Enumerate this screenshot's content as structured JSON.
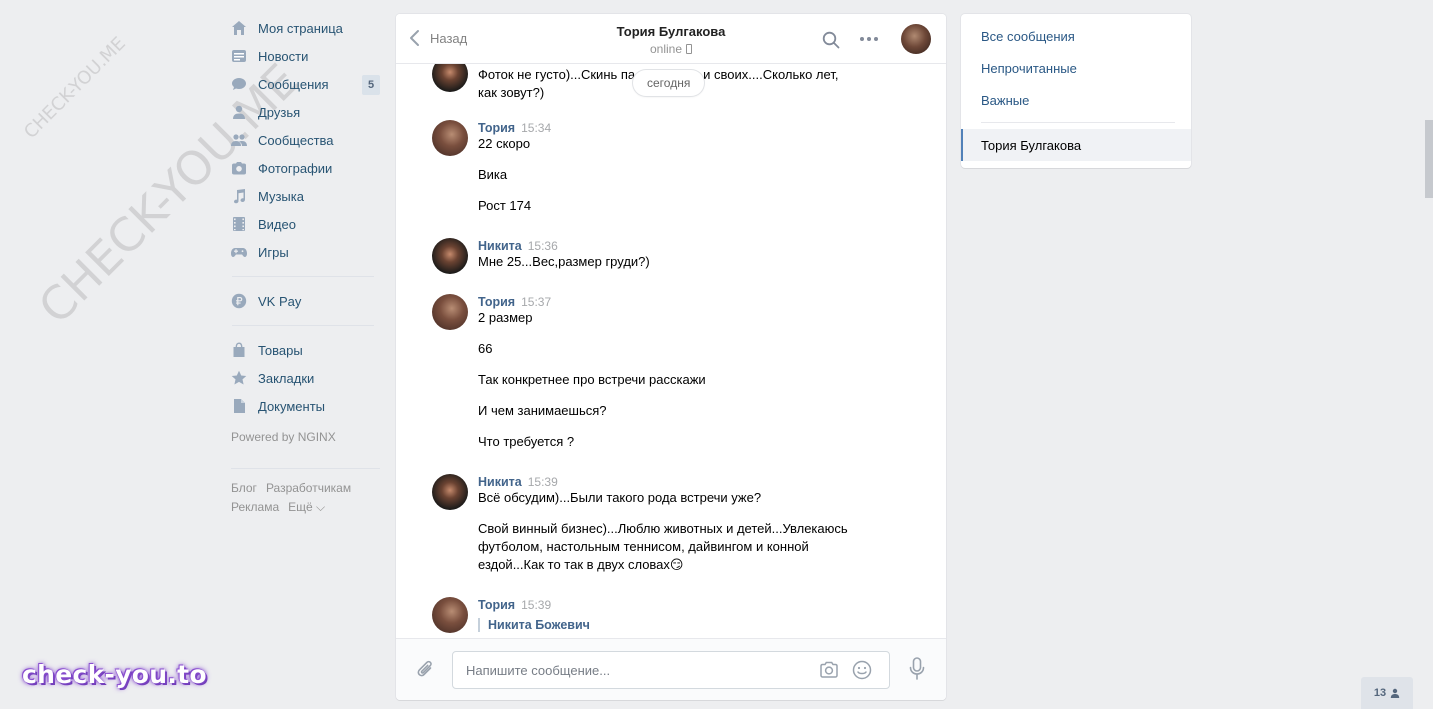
{
  "watermarks": {
    "small": "CHECK-YOU.ME",
    "big": "CHECK-YOU.ME",
    "bottom_logo": "check-you.to"
  },
  "left_nav": {
    "items": [
      {
        "label": "Моя страница",
        "icon": "home-icon"
      },
      {
        "label": "Новости",
        "icon": "news-icon"
      },
      {
        "label": "Сообщения",
        "icon": "messages-icon",
        "counter": "5"
      },
      {
        "label": "Друзья",
        "icon": "friends-icon"
      },
      {
        "label": "Сообщества",
        "icon": "communities-icon"
      },
      {
        "label": "Фотографии",
        "icon": "camera-icon"
      },
      {
        "label": "Музыка",
        "icon": "music-icon"
      },
      {
        "label": "Видео",
        "icon": "video-icon"
      },
      {
        "label": "Игры",
        "icon": "games-icon"
      }
    ],
    "vkpay": {
      "label": "VK Pay",
      "icon": "vkpay-icon"
    },
    "extra": [
      {
        "label": "Товары",
        "icon": "bag-icon"
      },
      {
        "label": "Закладки",
        "icon": "star-icon"
      },
      {
        "label": "Документы",
        "icon": "document-icon"
      }
    ],
    "powered": "Powered by NGINX",
    "footer": {
      "blog": "Блог",
      "dev": "Разработчикам",
      "ads": "Реклама",
      "more": "Ещё ⌵"
    }
  },
  "chat": {
    "back_label": "Назад",
    "peer_name": "Тория Булгакова",
    "peer_status": "online",
    "day_label": "сегодня",
    "partial_text": "Фоток не густо)...Скинь па",
    "partial_text_b": "и своих....Сколько лет,",
    "partial_text2": "как зовут?)",
    "messages": [
      {
        "author": "Тория",
        "time": "15:34",
        "lines": [
          "22 скоро",
          "Вика",
          "Рост 174"
        ]
      },
      {
        "author": "Никита",
        "time": "15:36",
        "lines": [
          "Мне 25...Вес,размер груди?)"
        ]
      },
      {
        "author": "Тория",
        "time": "15:37",
        "lines": [
          "2 размер",
          "66",
          "Так конкретнее про встречи расскажи",
          "И чем занимаешься?",
          "Что требуется ?"
        ]
      },
      {
        "author": "Никита",
        "time": "15:39",
        "lines": [
          "Всё обсудим)...Были такого рода встречи уже?",
          "Свой винный бизнес)...Люблю животных и детей...Увлекаюсь",
          "футболом, настольным теннисом, дайвингом и конной",
          "ездой...Как то так в двух словах😏"
        ]
      },
      {
        "author": "Тория",
        "time": "15:39",
        "reply_author": "Никита Божевич"
      }
    ],
    "composer_placeholder": "Напишите сообщение..."
  },
  "right_panel": {
    "all": "Все сообщения",
    "unread": "Непрочитанные",
    "important": "Важные",
    "active": "Тория Булгакова"
  },
  "online_counter": "13"
}
